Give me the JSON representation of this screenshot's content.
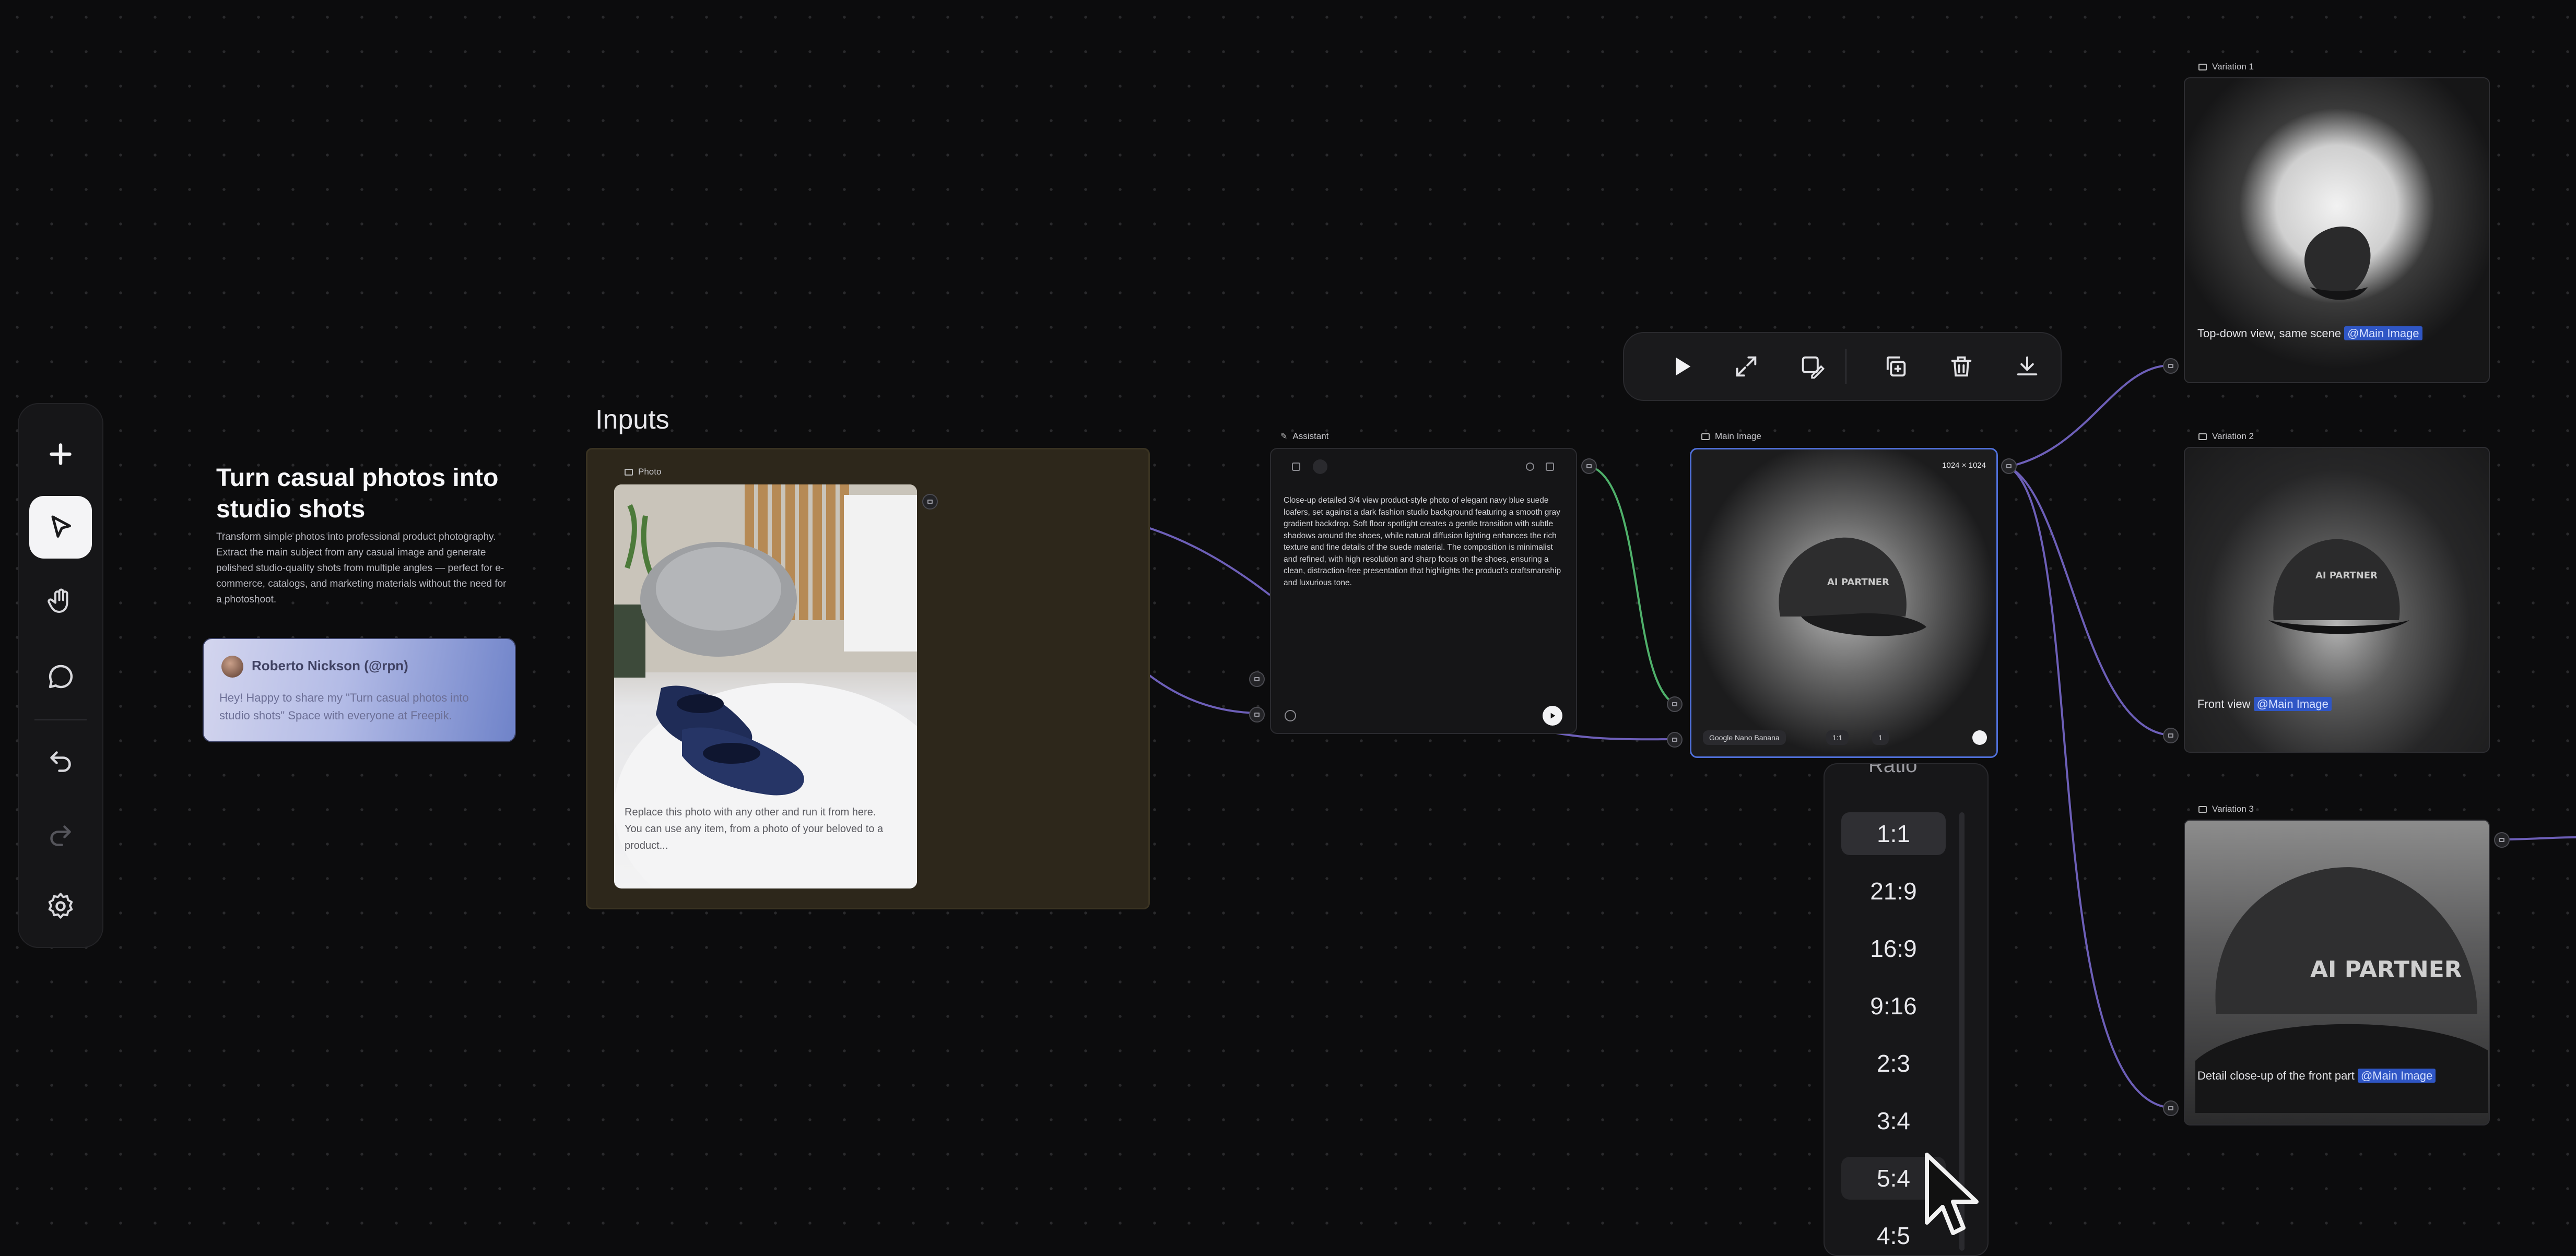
{
  "toolbar": {
    "items": [
      {
        "name": "add-icon"
      },
      {
        "name": "pointer-icon",
        "active": true
      },
      {
        "name": "hand-icon"
      },
      {
        "name": "comment-icon"
      },
      {
        "name": "undo-icon"
      },
      {
        "name": "redo-icon"
      },
      {
        "name": "settings-icon"
      }
    ]
  },
  "intro": {
    "title": "Turn casual photos into studio shots",
    "description": "Transform simple photos into professional product photography. Extract the main subject from any casual image and generate polished studio-quality shots from multiple angles — perfect for e-commerce, catalogs, and marketing materials without the need for a photoshoot."
  },
  "share": {
    "name": "Roberto Nickson (@rpn)",
    "message": "Hey! Happy to share my \"Turn casual photos into studio shots\" Space with everyone at Freepik."
  },
  "inputs_group": {
    "label": "Inputs",
    "photo_label": "Photo",
    "photo_caption": "Replace this photo with any other and run it from here. You can use any item, from a photo of your beloved to a product..."
  },
  "assistant": {
    "label": "Assistant",
    "text": "Close-up detailed 3/4 view product-style photo of elegant navy blue suede loafers, set against a dark fashion studio background featuring a smooth gray gradient backdrop. Soft floor spotlight creates a gentle transition with subtle shadows around the shoes, while natural diffusion lighting enhances the rich texture and fine details of the suede material. The composition is minimalist and refined, with high resolution and sharp focus on the shoes, ensuring a clean, distraction-free presentation that highlights the product's craftsmanship and luxurious tone."
  },
  "main_image": {
    "label": "Main Image",
    "resolution": "1024 × 1024",
    "model": "Google Nano Banana",
    "ratio": "1:1",
    "count": "1",
    "cap_text": "AI PARTNER"
  },
  "variations": [
    {
      "label": "Variation 1",
      "caption": "Top-down view, same scene",
      "mention": "@Main Image"
    },
    {
      "label": "Variation 2",
      "caption": "Front view",
      "mention": "@Main Image",
      "cap_text": "AI PARTNER"
    },
    {
      "label": "Variation 3",
      "caption": "Detail close-up of the front part",
      "mention": "@Main Image",
      "cap_text": "AI PARTNER"
    }
  ],
  "floating_toolbar": {
    "buttons": [
      "play-icon",
      "expand-icon",
      "edit-image-icon",
      "duplicate-icon",
      "trash-icon",
      "download-icon"
    ]
  },
  "ratio_dropdown": {
    "header": "Ratio",
    "options": [
      "1:1",
      "21:9",
      "16:9",
      "9:16",
      "2:3",
      "3:4",
      "5:4",
      "4:5"
    ],
    "selected": "1:1",
    "hovered": "5:4"
  },
  "colors": {
    "background": "#0c0c0d",
    "accent_blue": "#4f6fd8",
    "edge_purple": "#6d5fb8",
    "edge_green": "#4fb06a",
    "group_fill": "#2d271b"
  }
}
